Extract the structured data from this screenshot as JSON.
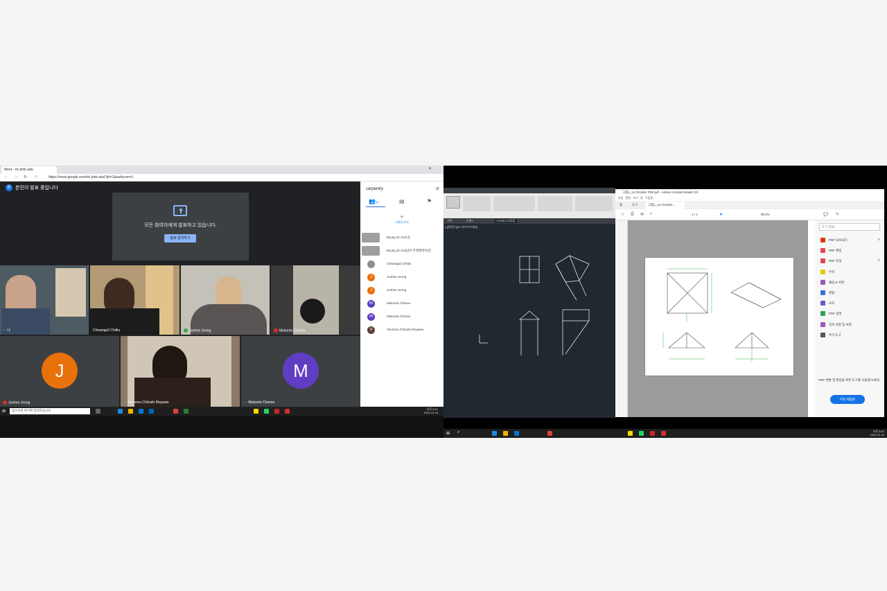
{
  "left": {
    "browser": {
      "tab_title": "Meet - rtc-jmik-ada",
      "url": "https://meet.google.com/rtc-jmik-ada?pli=1&authuser=1"
    },
    "meet": {
      "presenting_badge": "B",
      "presenting_banner": "본인이 발표 중입니다",
      "presentation_message": "모든 참여자에게 발표하고 있습니다.",
      "stop_presenting_label": "발표 중지하기",
      "tiles": [
        {
          "name": "나",
          "avatar": "",
          "color": "#546e7a"
        },
        {
          "name": "Chisanga2 Chitilu",
          "avatar": "",
          "color": "#7a6a55"
        },
        {
          "name": "Joohee Jeong",
          "avatar": "",
          "color": "#8a8a8a"
        },
        {
          "name": "Mukunta Chansa",
          "avatar": "",
          "color": "#6f6f6f"
        },
        {
          "name": "Joohee Jeong",
          "avatar": "J",
          "color": "#e8710a"
        },
        {
          "name": "Veronica Chilcafe Muyawa",
          "avatar": "",
          "color": "#4a3a2c"
        },
        {
          "name": "Mukunta Chansa",
          "avatar": "M",
          "color": "#5f3dc4"
        }
      ]
    },
    "sidepanel": {
      "title": "carpentry",
      "count": "(8)",
      "add_people_label": "사용자 추가",
      "participants": [
        {
          "initial": "",
          "name": "Byung Jin So(나)",
          "color": "#9e9e9e"
        },
        {
          "initial": "",
          "name": "Byung Jin So(님이 프레젠테이션)",
          "color": "#9e9e9e"
        },
        {
          "initial": "",
          "name": "Chisanga2 Chitilu",
          "color": "#8d8d8d"
        },
        {
          "initial": "J",
          "name": "Joohee Jeong",
          "color": "#e8710a"
        },
        {
          "initial": "J",
          "name": "Joohee Jeong",
          "color": "#e8710a"
        },
        {
          "initial": "M",
          "name": "Mukunta Chansa",
          "color": "#5f3dc4"
        },
        {
          "initial": "M",
          "name": "Mukunta Chansa",
          "color": "#5f3dc4"
        },
        {
          "initial": "V",
          "name": "Veronica Chilcafe Muyawa",
          "color": "#5d4037"
        }
      ]
    },
    "taskbar": {
      "search_placeholder": "찾으려면 여기에 입력하십시오.",
      "time": "오후 5:41",
      "date": "2020-10-16"
    }
  },
  "right": {
    "cad": {
      "tabs": [
        "시작",
        "도면1",
        "KOREA 거푸집"
      ],
      "view_label": "[-][평면도][2D 와이어프레임]"
    },
    "pdf": {
      "window_title": "그룹1_1a October PDF.pdf - Adobe Acrobat Reader DC",
      "menu": [
        "파일",
        "편집",
        "보기",
        "창",
        "도움말"
      ],
      "tabs": [
        "홈",
        "도구",
        "그룹1_1a October..."
      ],
      "zoom": "90.0%",
      "page": "1 / 1",
      "search_placeholder": "도구 검색",
      "tools": [
        {
          "label": "PDF 내보내기",
          "color": "#d83b01",
          "chevron": "∨"
        },
        {
          "label": "PDF 편집",
          "color": "#e34850",
          "chevron": ""
        },
        {
          "label": "PDF 작성",
          "color": "#e34850",
          "chevron": "∨"
        },
        {
          "label": "주석",
          "color": "#e8c600",
          "chevron": ""
        },
        {
          "label": "채움 & 서명",
          "color": "#9b59b6",
          "chevron": ""
        },
        {
          "label": "결합",
          "color": "#3b6fd4",
          "chevron": ""
        },
        {
          "label": "보호",
          "color": "#6a5acd",
          "chevron": ""
        },
        {
          "label": "PDF 압축",
          "color": "#2da44e",
          "chevron": ""
        },
        {
          "label": "전자 서명 및 서명",
          "color": "#9b59b6",
          "chevron": ""
        },
        {
          "label": "추가 도구",
          "color": "#555555",
          "chevron": ""
        }
      ],
      "promo_text": "PDF 변환 및 편집을 위한 도구를 사용해 보세요.",
      "promo_button": "무료 체험판"
    },
    "taskbar": {
      "time": "오후 5:41",
      "date": "2020-10-16"
    }
  }
}
